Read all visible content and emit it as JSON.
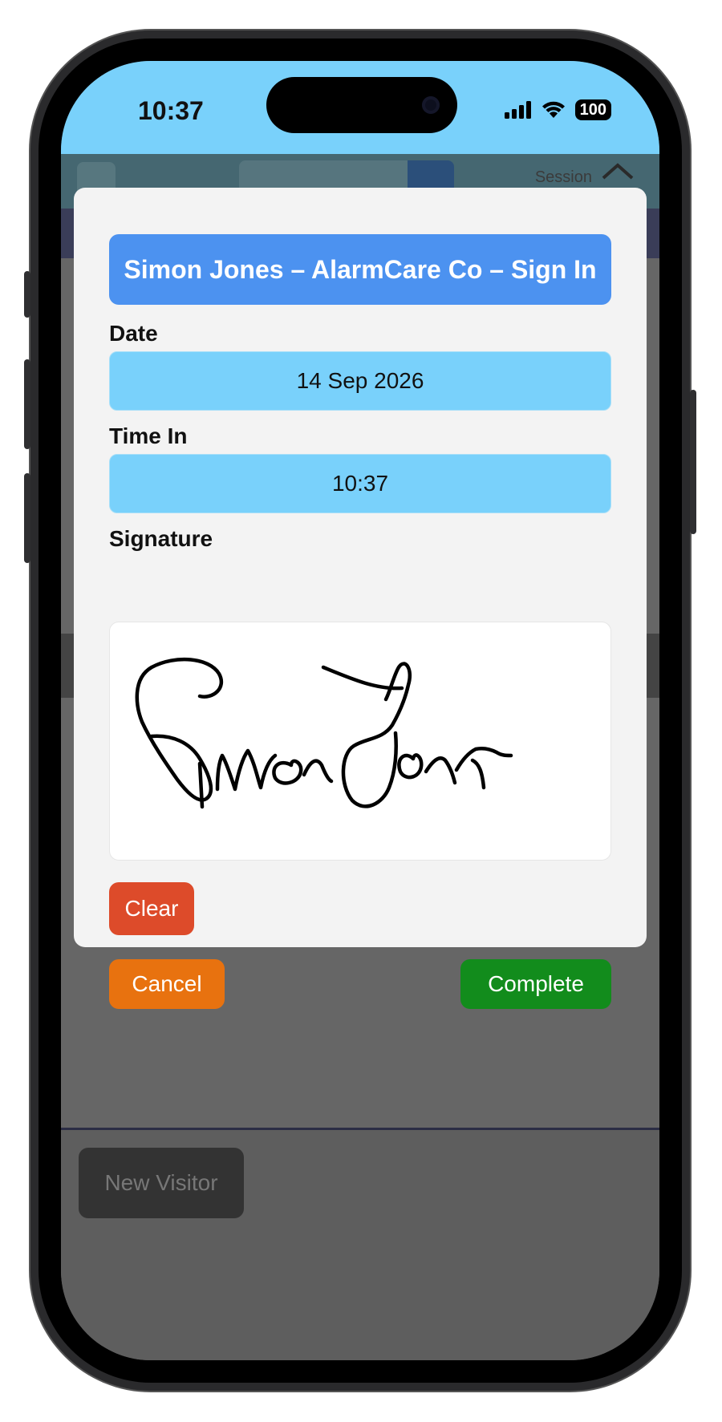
{
  "status_bar": {
    "time": "10:37",
    "battery": "100"
  },
  "background_app": {
    "session_label": "Session",
    "new_visitor_label": "New Visitor"
  },
  "modal": {
    "title": "Simon Jones – AlarmCare Co – Sign In",
    "date_label": "Date",
    "date_value": "14 Sep 2026",
    "time_in_label": "Time In",
    "time_in_value": "10:37",
    "signature_label": "Signature",
    "clear_label": "Clear",
    "cancel_label": "Cancel",
    "complete_label": "Complete"
  },
  "colors": {
    "status_bar_bg": "#79d1fb",
    "title_bg": "#4c92f0",
    "field_bg": "#79d1fb",
    "clear_bg": "#dd4b2a",
    "cancel_bg": "#e8720f",
    "complete_bg": "#128c1c"
  },
  "icons": [
    "cellular-signal-icon",
    "wifi-icon",
    "battery-icon",
    "camera-icon",
    "home-icon",
    "search-icon"
  ]
}
